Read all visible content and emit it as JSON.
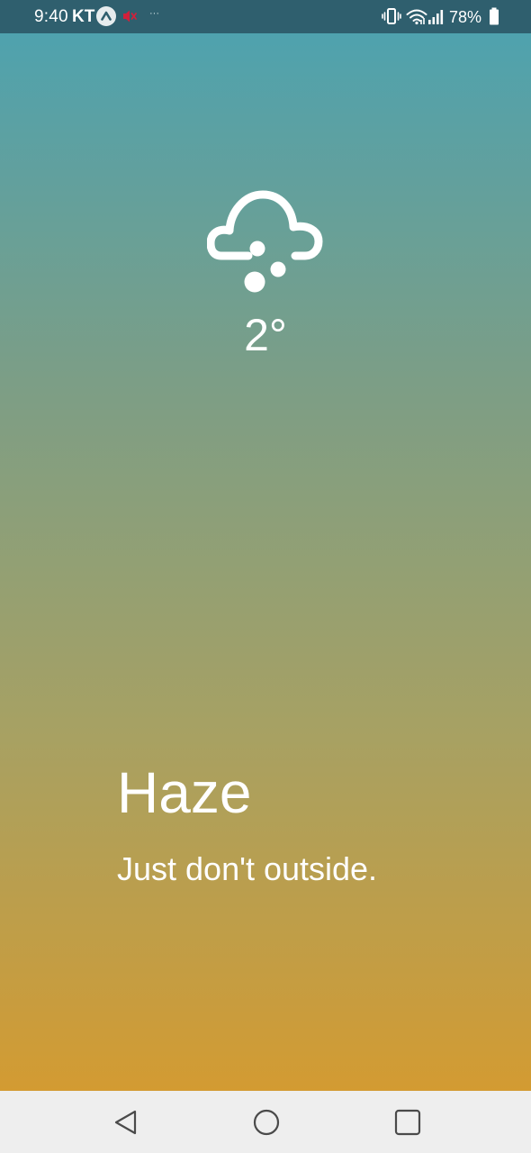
{
  "status_bar": {
    "time": "9:40",
    "carrier": "KT",
    "more_indicator": "···",
    "battery_percent": "78%",
    "icons": [
      "app-notification-icon",
      "mute-icon",
      "vibrate-icon",
      "wifi-icon",
      "signal-icon",
      "battery-icon"
    ],
    "background_color": "#2f5f6e"
  },
  "weather": {
    "icon": "haze-cloud-icon",
    "temperature": "2°",
    "condition": "Haze",
    "message": "Just don't outside."
  },
  "theme": {
    "gradient_top": "#4fa2ae",
    "gradient_bottom": "#d39b32",
    "text_color": "#ffffff"
  },
  "nav_bar": {
    "buttons": [
      "back-icon",
      "home-icon",
      "recents-icon"
    ]
  }
}
